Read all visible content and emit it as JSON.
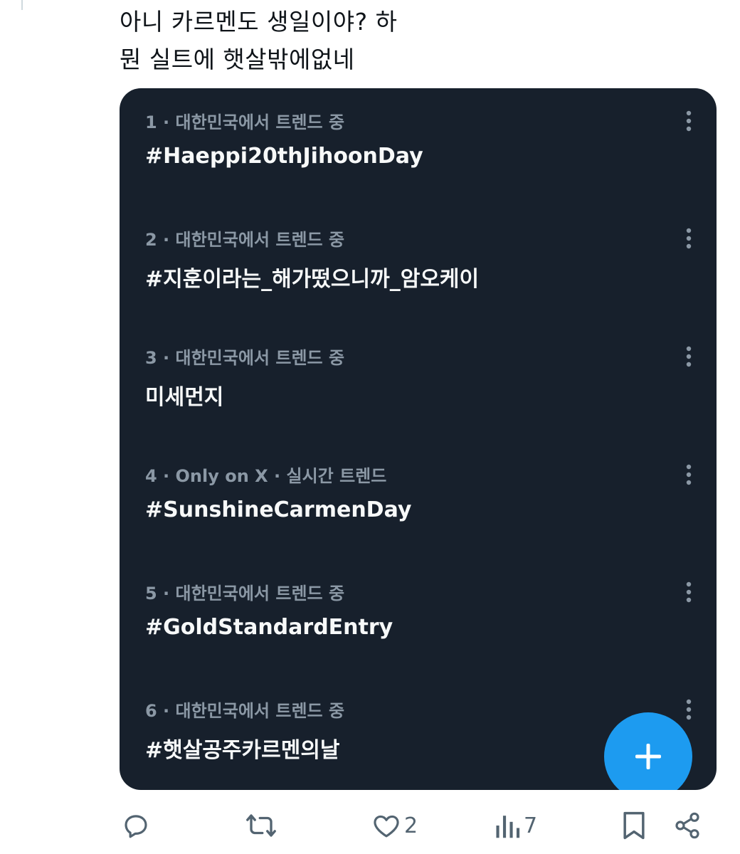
{
  "tweet": {
    "text_line1": "아니 카르멘도 생일이야? 하",
    "text_line2": "뭔 실트에 햇살밖에없네"
  },
  "trends": [
    {
      "meta": "1 · 대한민국에서 트렌드 중",
      "name": "#Haeppi20thJihoonDay"
    },
    {
      "meta": "2 · 대한민국에서 트렌드 중",
      "name": "#지훈이라는_해가떴으니까_암오케이"
    },
    {
      "meta": "3 · 대한민국에서 트렌드 중",
      "name": "미세먼지"
    },
    {
      "meta": "4 · Only on X · 실시간 트렌드",
      "name": "#SunshineCarmenDay"
    },
    {
      "meta": "5 · 대한민국에서 트렌드 중",
      "name": "#GoldStandardEntry"
    },
    {
      "meta": "6 · 대한민국에서 트렌드 중",
      "name": "#햇살공주카르멘의날"
    }
  ],
  "actions": {
    "reply_icon": "reply-icon",
    "retweet_icon": "retweet-icon",
    "like_icon": "heart-icon",
    "like_count": "2",
    "views_icon": "views-icon",
    "views_count": "7",
    "bookmark_icon": "bookmark-icon",
    "share_icon": "share-icon"
  },
  "colors": {
    "card_background": "#17202c",
    "trend_meta": "#8b98a5",
    "trend_name": "#f7f9f9",
    "fab": "#1d9bf0",
    "action_icon": "#536471"
  }
}
